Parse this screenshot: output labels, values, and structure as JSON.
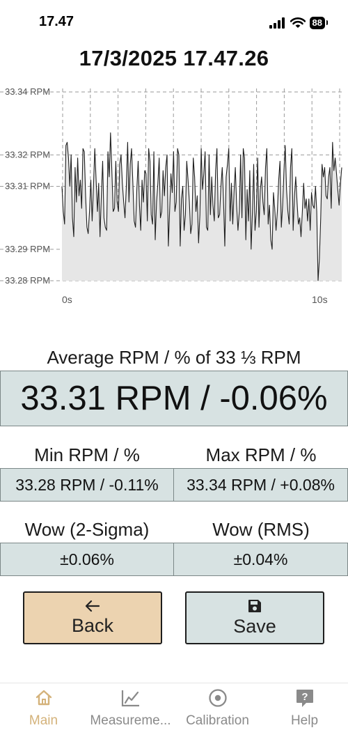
{
  "status_bar": {
    "time": "17.47",
    "battery": "88"
  },
  "header": {
    "title": "17/3/2025 17.47.26"
  },
  "chart_data": {
    "type": "area",
    "title": "",
    "xlabel": "",
    "ylabel": "",
    "x_range": [
      0,
      10
    ],
    "ylim": [
      33.28,
      33.34
    ],
    "y_ticks": [
      {
        "value": 33.34,
        "label": "33.34 RPM"
      },
      {
        "value": 33.32,
        "label": "33.32 RPM"
      },
      {
        "value": 33.31,
        "label": "33.31 RPM"
      },
      {
        "value": 33.29,
        "label": "33.29 RPM"
      },
      {
        "value": 33.28,
        "label": "33.28 RPM"
      }
    ],
    "x_ticks": [
      {
        "value": 0,
        "label": "0s"
      },
      {
        "value": 10,
        "label": "10s"
      }
    ],
    "grid": true,
    "series": [
      {
        "values": [
          33.31,
          33.302,
          33.298,
          33.323,
          33.324,
          33.319,
          33.31,
          33.32,
          33.3,
          33.294,
          33.316,
          33.305,
          33.319,
          33.307,
          33.312,
          33.303,
          33.322,
          33.321,
          33.307,
          33.297,
          33.295,
          33.302,
          33.312,
          33.299,
          33.31,
          33.322,
          33.312,
          33.302,
          33.311,
          33.294,
          33.307,
          33.318,
          33.3,
          33.297,
          33.296,
          33.321,
          33.313,
          33.327,
          33.315,
          33.302,
          33.303,
          33.318,
          33.305,
          33.302,
          33.317,
          33.32,
          33.311,
          33.305,
          33.3,
          33.31,
          33.324,
          33.305,
          33.317,
          33.322,
          33.311,
          33.299,
          33.297,
          33.309,
          33.318,
          33.304,
          33.296,
          33.312,
          33.305,
          33.315,
          33.314,
          33.299,
          33.322,
          33.318,
          33.301,
          33.298,
          33.321,
          33.293,
          33.305,
          33.311,
          33.319,
          33.3,
          33.302,
          33.315,
          33.307,
          33.316,
          33.32,
          33.291,
          33.303,
          33.314,
          33.308,
          33.321,
          33.302,
          33.305,
          33.322,
          33.32,
          33.291,
          33.306,
          33.31,
          33.296,
          33.301,
          33.318,
          33.312,
          33.305,
          33.295,
          33.298,
          33.319,
          33.313,
          33.302,
          33.307,
          33.292,
          33.301,
          33.322,
          33.309,
          33.314,
          33.321,
          33.297,
          33.296,
          33.32,
          33.301,
          33.313,
          33.304,
          33.299,
          33.315,
          33.322,
          33.3,
          33.301,
          33.31,
          33.316,
          33.306,
          33.291,
          33.313,
          33.317,
          33.322,
          33.299,
          33.311,
          33.298,
          33.308,
          33.316,
          33.304,
          33.296,
          33.302,
          33.32,
          33.3,
          33.322,
          33.319,
          33.293,
          33.309,
          33.299,
          33.315,
          33.29,
          33.302,
          33.317,
          33.296,
          33.302,
          33.319,
          33.297,
          33.309,
          33.313,
          33.305,
          33.301,
          33.316,
          33.322,
          33.298,
          33.304,
          33.293,
          33.29,
          33.308,
          33.303,
          33.296,
          33.302,
          33.312,
          33.318,
          33.297,
          33.304,
          33.315,
          33.323,
          33.309,
          33.302,
          33.298,
          33.316,
          33.322,
          33.296,
          33.307,
          33.313,
          33.305,
          33.298,
          33.3,
          33.294,
          33.302,
          33.311,
          33.303,
          33.306,
          33.299,
          33.306,
          33.296,
          33.308,
          33.304,
          33.303,
          33.31,
          33.302,
          33.28,
          33.287,
          33.3,
          33.317,
          33.313,
          33.316,
          33.307,
          33.306,
          33.313,
          33.316,
          33.303,
          33.324,
          33.315,
          33.319,
          33.314,
          33.309,
          33.304,
          33.311,
          33.316
        ]
      }
    ]
  },
  "average": {
    "label": "Average RPM / % of 33 ⅓ RPM",
    "value": "33.31 RPM / -0.06%"
  },
  "min": {
    "label": "Min RPM / %",
    "value": "33.28 RPM / -0.11%"
  },
  "max": {
    "label": "Max RPM / %",
    "value": "33.34 RPM / +0.08%"
  },
  "wow_2sigma": {
    "label": "Wow (2-Sigma)",
    "value": "±0.06%"
  },
  "wow_rms": {
    "label": "Wow (RMS)",
    "value": "±0.04%"
  },
  "buttons": {
    "back": {
      "label": "Back",
      "icon": "arrow-left-icon",
      "color": "#ecd3b0"
    },
    "save": {
      "label": "Save",
      "icon": "floppy-disk-icon",
      "color": "#d7e2e2"
    }
  },
  "tabs": [
    {
      "label": "Main",
      "icon": "home-icon",
      "active": true
    },
    {
      "label": "Measureme...",
      "icon": "line-chart-icon",
      "active": false
    },
    {
      "label": "Calibration",
      "icon": "target-icon",
      "active": false
    },
    {
      "label": "Help",
      "icon": "help-icon",
      "active": false
    }
  ],
  "colors": {
    "accent": "#d4b27a",
    "inactive": "#8a8a8a",
    "panel": "#d7e2e2"
  }
}
